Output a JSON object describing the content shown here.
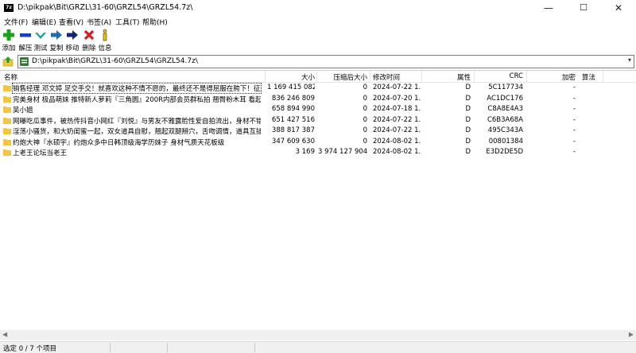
{
  "window": {
    "app_icon_text": "7z",
    "title": "D:\\pikpak\\Bit\\GRZL\\31-60\\GRZL54\\GRZL54.7z\\",
    "minimize": "—",
    "maximize": "☐",
    "close": "✕"
  },
  "menu": [
    "文件(F)",
    "编辑(E)",
    "查看(V)",
    "书签(A)",
    "工具(T)",
    "帮助(H)"
  ],
  "toolbar": {
    "add": "添加",
    "extract": "解压",
    "test": "测试",
    "copy": "复制",
    "move": "移动",
    "delete": "删除",
    "info": "信息"
  },
  "address": {
    "path": "D:\\pikpak\\Bit\\GRZL\\31-60\\GRZL54\\GRZL54.7z\\"
  },
  "columns": {
    "name": "名称",
    "size": "大小",
    "packed": "压缩后大小",
    "modified": "修改时间",
    "attr": "属性",
    "crc": "CRC",
    "encrypted": "加密",
    "method": "算法"
  },
  "rows": [
    {
      "name": "销售经理 邓文婷 足交手交！就喜欢这种不情不愿的，最终还不是得屈服在胯下！征服的...",
      "size": "1 169 415 082",
      "packed": "0",
      "modified": "2024-07-22 1...",
      "attr": "D",
      "crc": "5C117734",
      "encrypted": "-"
    },
    {
      "name": "完美身材 极品萌妹 推特新人萝莉『三角圆』200R内部会员群私拍 翘臀粉木耳 看起来没...",
      "size": "836 246 809",
      "packed": "0",
      "modified": "2024-07-20 1...",
      "attr": "D",
      "crc": "AC1DC176",
      "encrypted": "-"
    },
    {
      "name": "吴小姐",
      "size": "658 894 990",
      "packed": "0",
      "modified": "2024-07-18 1...",
      "attr": "D",
      "crc": "C8A8E4A3",
      "encrypted": "-"
    },
    {
      "name": "网曝吃瓜事件，被热传抖音小网红『刘悦』与男友不雅露脸性爱自拍流出，身材不错美腿...",
      "size": "651 427 516",
      "packed": "0",
      "modified": "2024-07-22 1...",
      "attr": "D",
      "crc": "C6B3A68A",
      "encrypted": "-"
    },
    {
      "name": "淫荡小骚货，和大奶闺蜜一起，双女道具自慰，翘起双腿掰穴，舌吻调情，道具互插骚逼...",
      "size": "388 817 387",
      "packed": "0",
      "modified": "2024-07-22 1...",
      "attr": "D",
      "crc": "495C343A",
      "encrypted": "-"
    },
    {
      "name": "约炮大神『水硕宇』约炮众多中日韩顶级海学历妹子 身材气质天花板级",
      "size": "347 609 630",
      "packed": "0",
      "modified": "2024-08-02 1...",
      "attr": "D",
      "crc": "00801384",
      "encrypted": "-"
    },
    {
      "name": "上老王论坛当老王",
      "size": "3 169",
      "packed": "3 974 127 904",
      "modified": "2024-08-02 1...",
      "attr": "D",
      "crc": "E3D2DE5D",
      "encrypted": "-"
    }
  ],
  "status": {
    "selection": "选定 0 / 7 个项目"
  },
  "colors": {
    "folder": "#f4c542",
    "add_icon": "#1aa31a",
    "extract_icon": "#1a3fbf",
    "test_icon": "#15a0a0",
    "copy_icon": "#1b6fb0",
    "move_icon": "#14237a",
    "delete_icon": "#d81c1c",
    "info_icon": "#e6c200"
  }
}
